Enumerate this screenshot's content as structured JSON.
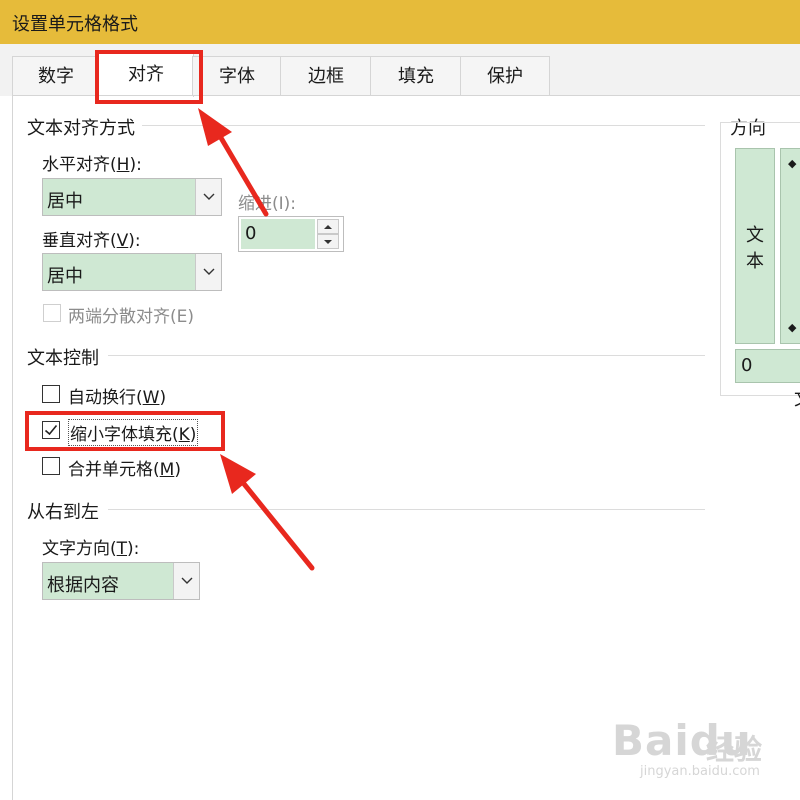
{
  "window": {
    "title": "设置单元格格式"
  },
  "tabs": [
    {
      "label": "数字",
      "active": false
    },
    {
      "label": "对齐",
      "active": true
    },
    {
      "label": "字体",
      "active": false
    },
    {
      "label": "边框",
      "active": false
    },
    {
      "label": "填充",
      "active": false
    },
    {
      "label": "保护",
      "active": false
    }
  ],
  "text_alignment": {
    "section_title": "文本对齐方式",
    "horizontal_label_pre": "水平对齐(",
    "horizontal_label_key": "H",
    "horizontal_label_post": "):",
    "horizontal_value": "居中",
    "vertical_label_pre": "垂直对齐(",
    "vertical_label_key": "V",
    "vertical_label_post": "):",
    "vertical_value": "居中",
    "indent_label": "缩进(I):",
    "indent_value": "0",
    "justify_distributed_label": "两端分散对齐(E)",
    "justify_distributed_checked": false
  },
  "text_control": {
    "section_title": "文本控制",
    "wrap_pre": "自动换行(",
    "wrap_key": "W",
    "wrap_post": ")",
    "wrap_checked": false,
    "shrink_pre": "缩小字体填充(",
    "shrink_key": "K",
    "shrink_post": ")",
    "shrink_checked": true,
    "merge_pre": "合并单元格(",
    "merge_key": "M",
    "merge_post": ")",
    "merge_checked": false
  },
  "rtl": {
    "section_title": "从右到左",
    "direction_label_pre": "文字方向(",
    "direction_label_key": "T",
    "direction_label_post": "):",
    "direction_value": "根据内容"
  },
  "orientation": {
    "section_title": "方向",
    "vertical_text_1": "文",
    "vertical_text_2": "本",
    "partial_text": "文",
    "degrees_value": "0"
  },
  "watermark": {
    "brand": "Baidu",
    "brand_cn": "经验",
    "url": "jingyan.baidu.com"
  },
  "colors": {
    "titlebar": "#e6bb3a",
    "field_fill": "#cfe8d3",
    "annotation": "#e8281e"
  }
}
